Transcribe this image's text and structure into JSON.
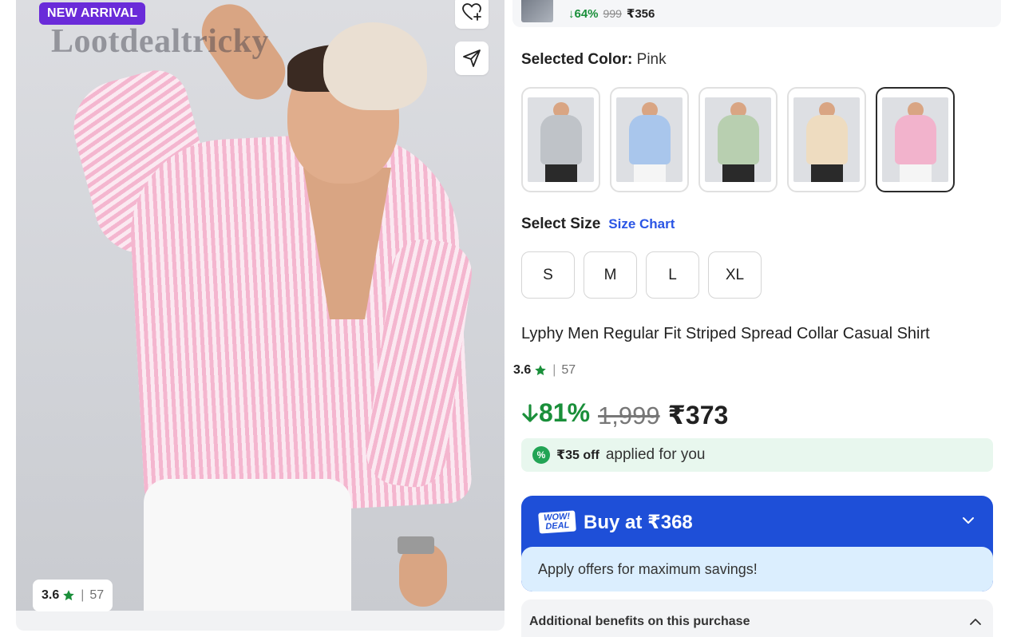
{
  "gallery": {
    "badge": "NEW ARRIVAL",
    "watermark": "Lootdealtricky",
    "rating": {
      "value": "3.6",
      "count": "57"
    }
  },
  "top_item": {
    "discount": "64%",
    "mrp": "999",
    "price": "₹356"
  },
  "color": {
    "label": "Selected Color:",
    "value": "Pink",
    "options": [
      {
        "name": "Grey",
        "hex": "#bfc3c8",
        "pants": "#2a2a2a"
      },
      {
        "name": "Blue",
        "hex": "#a9c6ec",
        "pants": "#f5f5f5"
      },
      {
        "name": "Green",
        "hex": "#b8cfb0",
        "pants": "#2a2a2a"
      },
      {
        "name": "Beige",
        "hex": "#eedcc0",
        "pants": "#2a2a2a"
      },
      {
        "name": "Pink",
        "hex": "#f2b3cc",
        "pants": "#f5f5f5"
      }
    ]
  },
  "size": {
    "label": "Select Size",
    "chart_link": "Size Chart",
    "options": [
      "S",
      "M",
      "L",
      "XL"
    ]
  },
  "product": {
    "title": "Lyphy Men Regular Fit Striped Spread Collar Casual Shirt",
    "rating": {
      "value": "3.6",
      "count": "57"
    }
  },
  "price": {
    "discount": "81%",
    "mrp": "1,999",
    "selling": "₹373"
  },
  "applied_offer": {
    "amount": "₹35 off",
    "text": "applied for you"
  },
  "buy": {
    "badge_line1": "WOW!",
    "badge_line2": "DEAL",
    "label": "Buy at ₹368",
    "sub": "Apply offers for maximum savings!"
  },
  "benefits": {
    "label": "Additional benefits on this purchase"
  },
  "colors": {
    "accent_blue": "#1e4fd8",
    "discount_green": "#1a8f3a",
    "badge_purple": "#6a2bd9"
  }
}
